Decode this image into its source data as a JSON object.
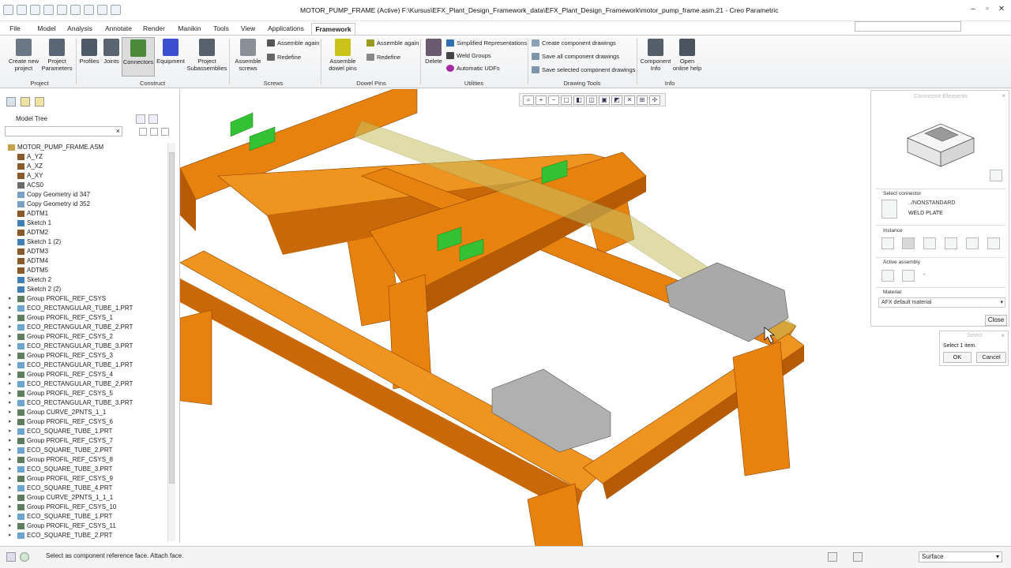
{
  "window": {
    "title": "MOTOR_PUMP_FRAME (Active) F:\\Kursus\\EFX_Plant_Design_Framework_data\\EFX_Plant_Design_Framework\\motor_pump_frame.asm.21 - Creo Parametric"
  },
  "menu_tabs": [
    "File",
    "Model",
    "Analysis",
    "Annotate",
    "Render",
    "Manikin",
    "Tools",
    "View",
    "Applications",
    "Framework"
  ],
  "active_tab": "Framework",
  "ribbon": {
    "project": {
      "create": "Create new project",
      "params": "Project Parameters",
      "group": "Project"
    },
    "construct": {
      "profiles": "Profiles",
      "joints": "Joints",
      "connectors": "Connectors",
      "equipment": "Equipment",
      "subassemblies": "Project Subassemblies",
      "group": "Construct"
    },
    "screws": {
      "assemble_screws": "Assemble screws",
      "assemble_again": "Assemble again",
      "redefine": "Redefine",
      "group": "Screws"
    },
    "dowel": {
      "assemble_dowel": "Assemble dowel pins",
      "assemble_again": "Assemble again",
      "redefine": "Redefine",
      "group": "Dowel Pins"
    },
    "utilities": {
      "delete": "Delete",
      "simplified": "Simplified Representations",
      "weld": "Weld Groups",
      "udfs": "Automatic UDFs",
      "group": "Utilities"
    },
    "drawing": {
      "create": "Create component drawings",
      "save_all": "Save all component drawings",
      "save_sel": "Save selected component drawings",
      "group": "Drawing Tools"
    },
    "info": {
      "component": "Component Info",
      "help": "Open online help",
      "group": "Info"
    }
  },
  "model_tree": {
    "title": "Model Tree",
    "items": [
      {
        "label": "MOTOR_PUMP_FRAME.ASM",
        "type": "asm",
        "level": 0
      },
      {
        "label": "A_YZ",
        "type": "datum",
        "level": 1
      },
      {
        "label": "A_XZ",
        "type": "datum",
        "level": 1
      },
      {
        "label": "A_XY",
        "type": "datum",
        "level": 1
      },
      {
        "label": "ACS0",
        "type": "csys",
        "level": 1
      },
      {
        "label": "Copy Geometry id 347",
        "type": "copy",
        "level": 1
      },
      {
        "label": "Copy Geometry id 352",
        "type": "copy",
        "level": 1
      },
      {
        "label": "ADTM1",
        "type": "datum",
        "level": 1
      },
      {
        "label": "Sketch 1",
        "type": "sketch",
        "level": 1
      },
      {
        "label": "ADTM2",
        "type": "datum",
        "level": 1
      },
      {
        "label": "Sketch 1 (2)",
        "type": "sketch",
        "level": 1
      },
      {
        "label": "ADTM3",
        "type": "datum",
        "level": 1
      },
      {
        "label": "ADTM4",
        "type": "datum",
        "level": 1
      },
      {
        "label": "ADTM5",
        "type": "datum",
        "level": 1
      },
      {
        "label": "Sketch 2",
        "type": "sketch",
        "level": 1
      },
      {
        "label": "Sketch 2 (2)",
        "type": "sketch",
        "level": 1
      },
      {
        "label": "Group PROFIL_REF_CSYS",
        "type": "group",
        "level": 1
      },
      {
        "label": "ECO_RECTANGULAR_TUBE_1.PRT",
        "type": "part",
        "level": 1
      },
      {
        "label": "Group PROFIL_REF_CSYS_1",
        "type": "group",
        "level": 1
      },
      {
        "label": "ECO_RECTANGULAR_TUBE_2.PRT",
        "type": "part",
        "level": 1
      },
      {
        "label": "Group PROFIL_REF_CSYS_2",
        "type": "group",
        "level": 1
      },
      {
        "label": "ECO_RECTANGULAR_TUBE_3.PRT",
        "type": "part",
        "level": 1
      },
      {
        "label": "Group PROFIL_REF_CSYS_3",
        "type": "group",
        "level": 1
      },
      {
        "label": "ECO_RECTANGULAR_TUBE_1.PRT",
        "type": "part",
        "level": 1
      },
      {
        "label": "Group PROFIL_REF_CSYS_4",
        "type": "group",
        "level": 1
      },
      {
        "label": "ECO_RECTANGULAR_TUBE_2.PRT",
        "type": "part",
        "level": 1
      },
      {
        "label": "Group PROFIL_REF_CSYS_5",
        "type": "group",
        "level": 1
      },
      {
        "label": "ECO_RECTANGULAR_TUBE_3.PRT",
        "type": "part",
        "level": 1
      },
      {
        "label": "Group CURVE_2PNTS_1_1",
        "type": "group",
        "level": 1
      },
      {
        "label": "Group PROFIL_REF_CSYS_6",
        "type": "group",
        "level": 1
      },
      {
        "label": "ECO_SQUARE_TUBE_1.PRT",
        "type": "part",
        "level": 1
      },
      {
        "label": "Group PROFIL_REF_CSYS_7",
        "type": "group",
        "level": 1
      },
      {
        "label": "ECO_SQUARE_TUBE_2.PRT",
        "type": "part",
        "level": 1
      },
      {
        "label": "Group PROFIL_REF_CSYS_8",
        "type": "group",
        "level": 1
      },
      {
        "label": "ECO_SQUARE_TUBE_3.PRT",
        "type": "part",
        "level": 1
      },
      {
        "label": "Group PROFIL_REF_CSYS_9",
        "type": "group",
        "level": 1
      },
      {
        "label": "ECO_SQUARE_TUBE_4.PRT",
        "type": "part",
        "level": 1
      },
      {
        "label": "Group CURVE_2PNTS_1_1_1",
        "type": "group",
        "level": 1
      },
      {
        "label": "Group PROFIL_REF_CSYS_10",
        "type": "group",
        "level": 1
      },
      {
        "label": "ECO_SQUARE_TUBE_1.PRT",
        "type": "part",
        "level": 1
      },
      {
        "label": "Group PROFIL_REF_CSYS_11",
        "type": "group",
        "level": 1
      },
      {
        "label": "ECO_SQUARE_TUBE_2.PRT",
        "type": "part",
        "level": 1
      }
    ]
  },
  "dashboard": {
    "title": "Connector Elements",
    "select_connector_label": "Select connector",
    "connector_path": "../NONSTANDARD",
    "connector_name": "WELD PLATE",
    "instance_label": "Instance",
    "active_assembly_label": "Active assembly",
    "active_assembly_value": "-",
    "material_label": "Material",
    "material_value": "AFX default material",
    "close": "Close"
  },
  "select_dialog": {
    "title": "Select",
    "prompt": "Select 1 item.",
    "ok": "OK",
    "cancel": "Cancel"
  },
  "status": {
    "message": "Select as component reference face. Attach face.",
    "filter": "Surface"
  },
  "colors": {
    "frame_orange": "#e8820f",
    "frame_dark": "#b55a05",
    "highlight_green": "#33c233",
    "plate_grey": "#9a9a9a"
  }
}
